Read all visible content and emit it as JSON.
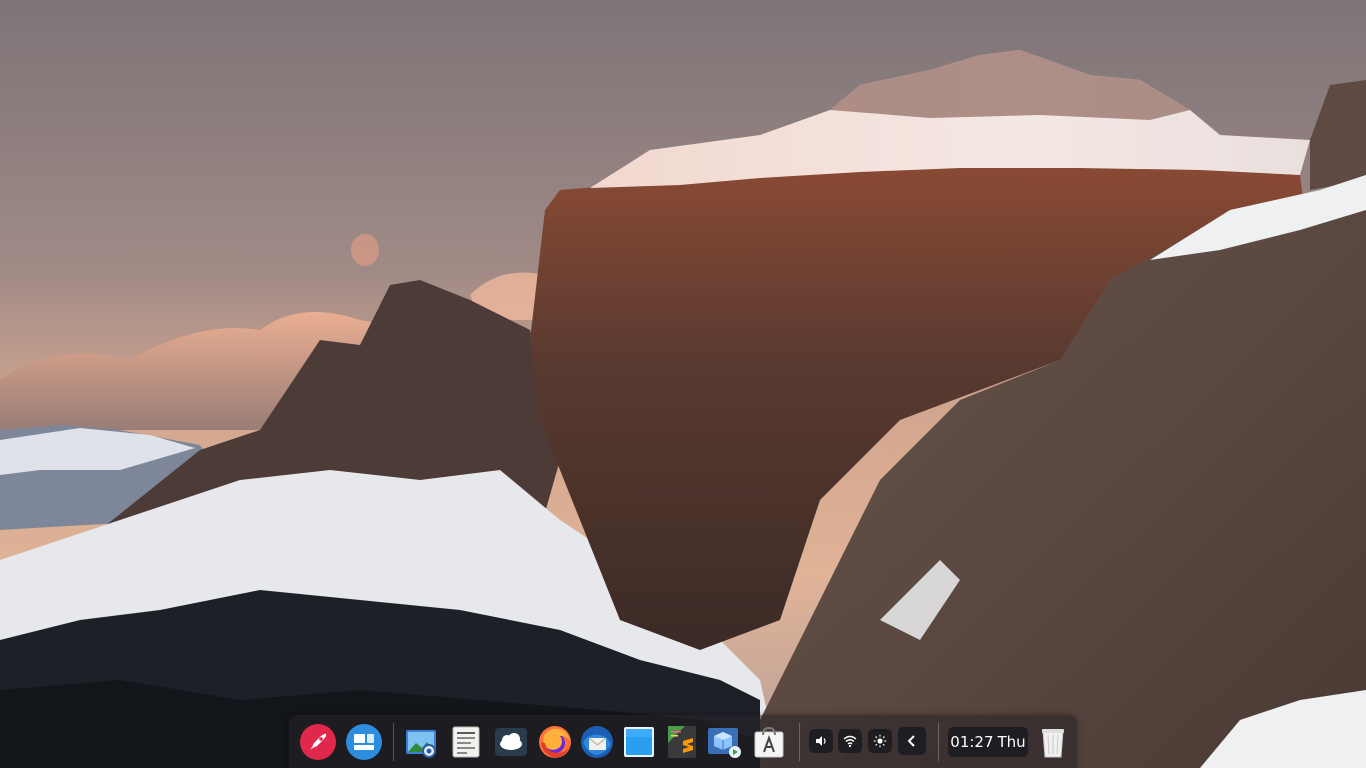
{
  "desktop": {
    "wallpaper_icon": "mountain-sunset-wallpaper"
  },
  "dock": {
    "apps": [
      {
        "icon": "launcher-rocket-icon",
        "color": "#e0284a"
      },
      {
        "icon": "multitasking-view-icon",
        "color": "#2d8ee0"
      },
      {
        "icon": "image-viewer-icon",
        "color": "#3c7fd8"
      },
      {
        "icon": "text-editor-icon",
        "color": "#f2f2ee"
      },
      {
        "icon": "nextcloud-icon",
        "color": "#2a3b4e"
      },
      {
        "icon": "firefox-icon",
        "color": "#ff7139"
      },
      {
        "icon": "mail-client-icon",
        "color": "#1b5fb4"
      },
      {
        "icon": "blue-app-icon",
        "color": "#2a9ff0"
      },
      {
        "icon": "sublime-text-icon",
        "color": "#ff9800"
      },
      {
        "icon": "package-installer-icon",
        "color": "#4a8ad6"
      },
      {
        "icon": "app-store-icon",
        "color": "#f5f5f5"
      }
    ],
    "tray": {
      "volume_icon": "volume-icon",
      "wifi_icon": "wifi-icon",
      "brightness_icon": "brightness-icon",
      "collapse_icon": "chevron-left-icon"
    },
    "clock": {
      "time": "01:27",
      "day": "Thu"
    },
    "trash_icon": "trash-icon"
  }
}
